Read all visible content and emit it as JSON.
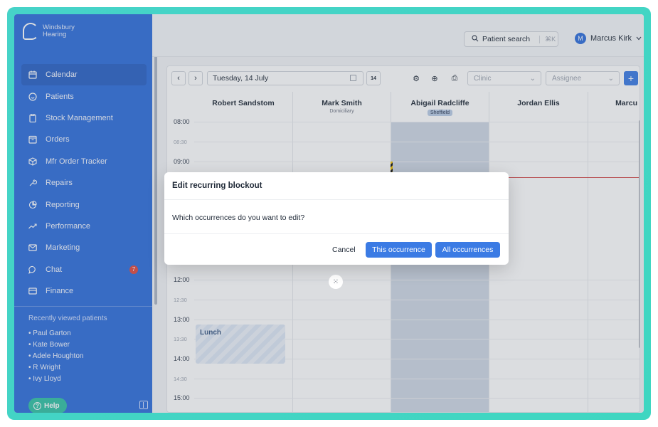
{
  "brand": {
    "name_line1": "Windsbury",
    "name_line2": "Hearing"
  },
  "sidebar": {
    "items": [
      {
        "label": "Calendar",
        "icon": "calendar-icon"
      },
      {
        "label": "Patients",
        "icon": "smile-icon"
      },
      {
        "label": "Stock Management",
        "icon": "clipboard-icon"
      },
      {
        "label": "Orders",
        "icon": "order-box-icon"
      },
      {
        "label": "Mfr Order Tracker",
        "icon": "cube-icon"
      },
      {
        "label": "Repairs",
        "icon": "wrench-icon"
      },
      {
        "label": "Reporting",
        "icon": "pie-chart-icon"
      },
      {
        "label": "Performance",
        "icon": "trend-icon"
      },
      {
        "label": "Marketing",
        "icon": "mail-icon"
      },
      {
        "label": "Chat",
        "icon": "chat-icon",
        "badge": "7"
      },
      {
        "label": "Finance",
        "icon": "card-icon"
      }
    ],
    "recent_title": "Recently viewed patients",
    "recent": [
      "• Paul Garton",
      "• Kate Bower",
      "• Adele Houghton",
      "• R Wright",
      "• Ivy Lloyd"
    ],
    "help_label": "Help"
  },
  "topbar": {
    "search_label": "Patient search",
    "shortcut": "⌘K",
    "user_initial": "M",
    "user_name": "Marcus Kirk"
  },
  "toolbar": {
    "date": "Tuesday, 14 July",
    "calendar_day": "14",
    "clinic_placeholder": "Clinic",
    "assignee_placeholder": "Assignee",
    "add_label": "+"
  },
  "columns": [
    {
      "name": "Robert Sandstom",
      "sub": ""
    },
    {
      "name": "Mark Smith",
      "sub": "Domiciliary"
    },
    {
      "name": "Abigail Radcliffe",
      "tag": "Sheffield"
    },
    {
      "name": "Jordan Ellis",
      "sub": ""
    },
    {
      "name": "Marcu",
      "sub": ""
    }
  ],
  "times": [
    "08:00",
    "08:30",
    "09:00",
    "12:00",
    "12:30",
    "13:00",
    "13:30",
    "14:00",
    "14:30",
    "15:00"
  ],
  "event": {
    "label": "Lunch"
  },
  "modal": {
    "title": "Edit recurring blockout",
    "question": "Which occurrences do you want to edit?",
    "cancel": "Cancel",
    "this_occurrence": "This occurrence",
    "all_occurrences": "All occurrences"
  },
  "colors": {
    "brand": "#2f6fdb",
    "primary": "#3b7be4",
    "help": "#31c2a5",
    "badge": "#e04a3f",
    "frame": "#46d3c8"
  }
}
